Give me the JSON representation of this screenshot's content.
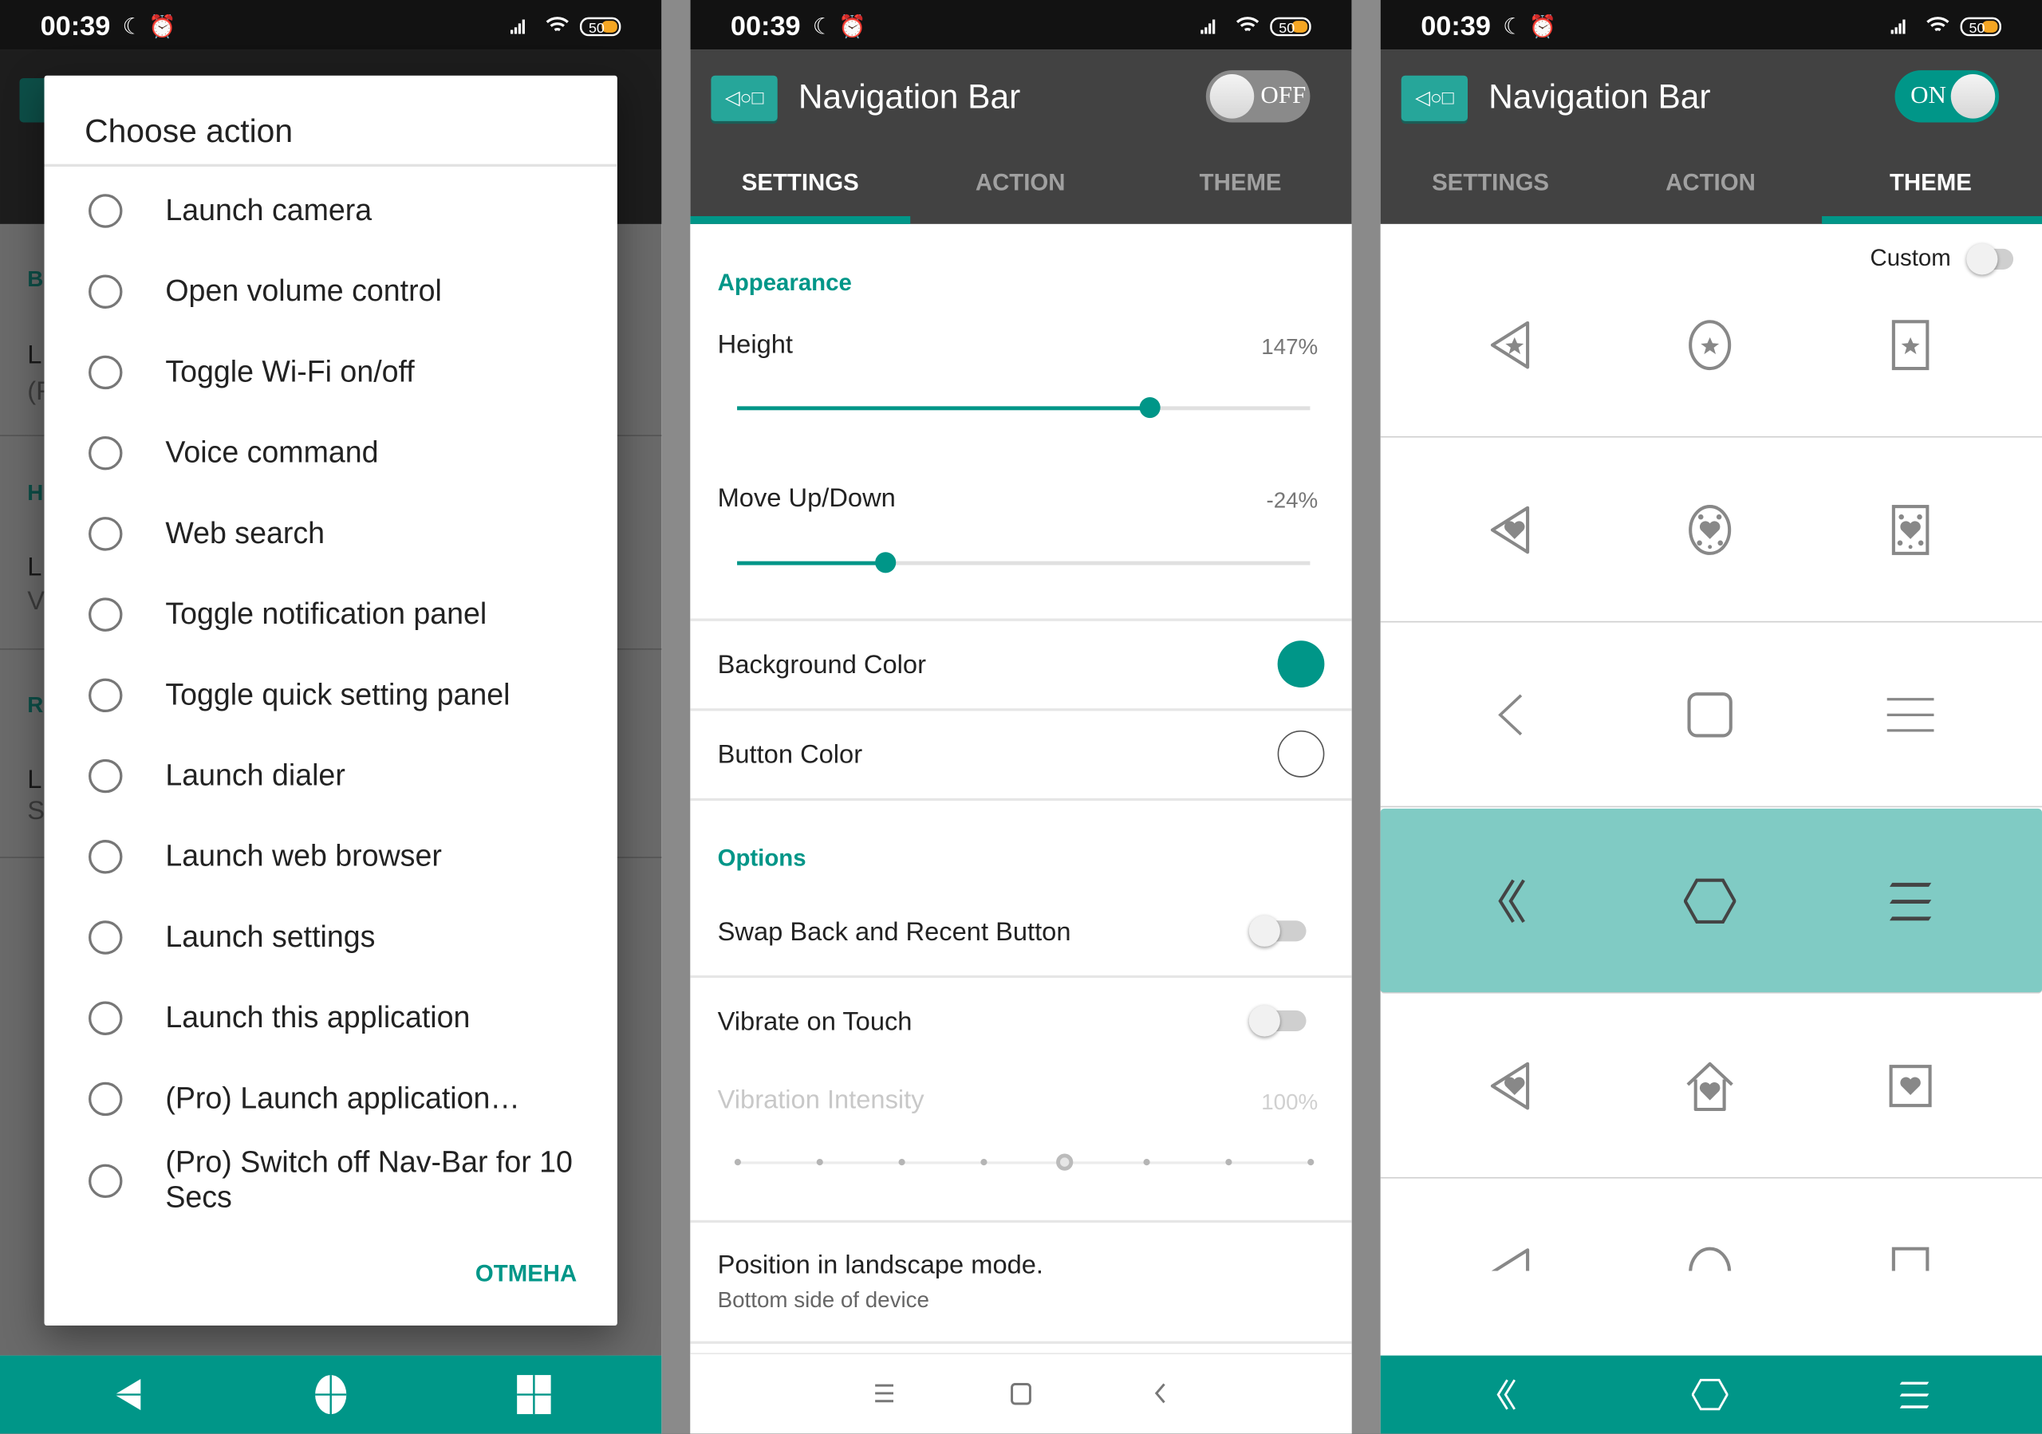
{
  "status_bar": {
    "time": "00:39",
    "battery": "50"
  },
  "colors": {
    "accent": "#009688",
    "selected_row": "#80cbc4",
    "appbar": "#424242",
    "status_bar": "#121212"
  },
  "left_panel": {
    "background_fragments": [
      {
        "text": "B",
        "kind": "header"
      },
      {
        "text": "L",
        "kind": "title"
      },
      {
        "text": "(F",
        "kind": "sub"
      },
      {
        "text": "H",
        "kind": "header"
      },
      {
        "text": "L",
        "kind": "title"
      },
      {
        "text": "V",
        "kind": "sub"
      },
      {
        "text": "R",
        "kind": "header"
      },
      {
        "text": "L",
        "kind": "title"
      },
      {
        "text": "S",
        "kind": "sub"
      }
    ],
    "dialog": {
      "title": "Choose action",
      "items": [
        "Launch camera",
        "Open volume control",
        "Toggle Wi-Fi on/off",
        "Voice command",
        "Web search",
        "Toggle notification panel",
        "Toggle quick setting panel",
        "Launch dialer",
        "Launch web browser",
        "Launch settings",
        "Launch this application",
        "(Pro) Launch application…",
        "(Pro) Switch off Nav-Bar for 10 Secs"
      ],
      "cancel_label": "OTMEHA"
    },
    "nav_icons": [
      "triangle-back-icon",
      "oval-home-icon",
      "window-recent-icon"
    ]
  },
  "middle_panel": {
    "title": "Navigation Bar",
    "toggle_label": "OFF",
    "toggle_on": false,
    "tabs": [
      {
        "label": "SETTINGS",
        "active": true
      },
      {
        "label": "ACTION",
        "active": false
      },
      {
        "label": "THEME",
        "active": false
      }
    ],
    "appearance_header": "Appearance",
    "height": {
      "label": "Height",
      "value": "147%",
      "fraction": 0.72
    },
    "move": {
      "label": "Move Up/Down",
      "value": "-24%",
      "fraction": 0.26
    },
    "background_color": {
      "label": "Background Color",
      "color": "#009688"
    },
    "button_color": {
      "label": "Button Color",
      "color": "#ffffff"
    },
    "options_header": "Options",
    "swap": {
      "label": "Swap Back and Recent Button",
      "on": false
    },
    "vibrate": {
      "label": "Vibrate on Touch",
      "on": false
    },
    "vibration_intensity": {
      "label": "Vibration Intensity",
      "value": "100%",
      "steps": 8,
      "selected_step": 4,
      "enabled": false
    },
    "landscape": {
      "label": "Position in landscape mode.",
      "value": "Bottom side of device"
    },
    "nav_icons": [
      "menu-icon",
      "square-home-icon",
      "chevron-back-icon"
    ]
  },
  "right_panel": {
    "title": "Navigation Bar",
    "toggle_label": "ON",
    "toggle_on": true,
    "tabs": [
      {
        "label": "SETTINGS",
        "active": false
      },
      {
        "label": "ACTION",
        "active": false
      },
      {
        "label": "THEME",
        "active": true
      }
    ],
    "custom_label": "Custom",
    "custom_on": false,
    "themes": [
      {
        "icons": [
          "triangle-star-icon",
          "circle-star-icon",
          "rect-star-icon"
        ]
      },
      {
        "icons": [
          "triangle-hearts-icon",
          "circle-hearts-icon",
          "rect-hearts-icon"
        ]
      },
      {
        "icons": [
          "chevron-icon",
          "rounded-square-icon",
          "three-lines-icon"
        ]
      },
      {
        "icons": [
          "double-chevron-icon",
          "hexagon-icon",
          "slanted-lines-icon"
        ],
        "selected": true
      },
      {
        "icons": [
          "triangle-heart-icon",
          "house-heart-icon",
          "square-heart-icon"
        ]
      },
      {
        "icons": [
          "triangle-flower-icon",
          "circle-flower-icon",
          "rect-flower-icon"
        ]
      }
    ],
    "nav_icons": [
      "double-chevron-icon",
      "hexagon-icon",
      "slanted-lines-icon"
    ]
  }
}
